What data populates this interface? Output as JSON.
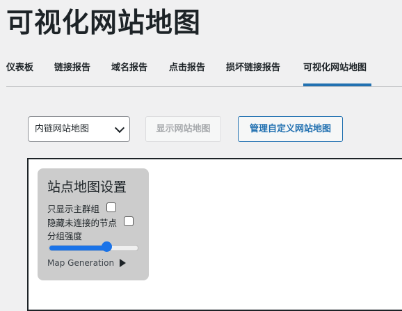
{
  "page": {
    "title": "可视化网站地图"
  },
  "tabs": [
    {
      "label": "仪表板"
    },
    {
      "label": "链接报告"
    },
    {
      "label": "域名报告"
    },
    {
      "label": "点击报告"
    },
    {
      "label": "损坏链接报告"
    },
    {
      "label": "可视化网站地图",
      "active": true
    }
  ],
  "controls": {
    "sitemap_select": {
      "value": "内链网站地图"
    },
    "show_button": "显示网站地图",
    "manage_button": "管理自定义网站地图"
  },
  "settings": {
    "title": "站点地图设置",
    "main_groups_only": {
      "label": "只显示主群组",
      "checked": false
    },
    "hide_unconnected": {
      "label": "隐藏未连接的节点",
      "checked": false
    },
    "group_strength": {
      "label": "分组强度",
      "value": 0.65
    },
    "map_generation": "Map Generation"
  },
  "colors": {
    "accent": "#2271b1",
    "slider": "#1a73e8",
    "panel": "#cccccc"
  }
}
